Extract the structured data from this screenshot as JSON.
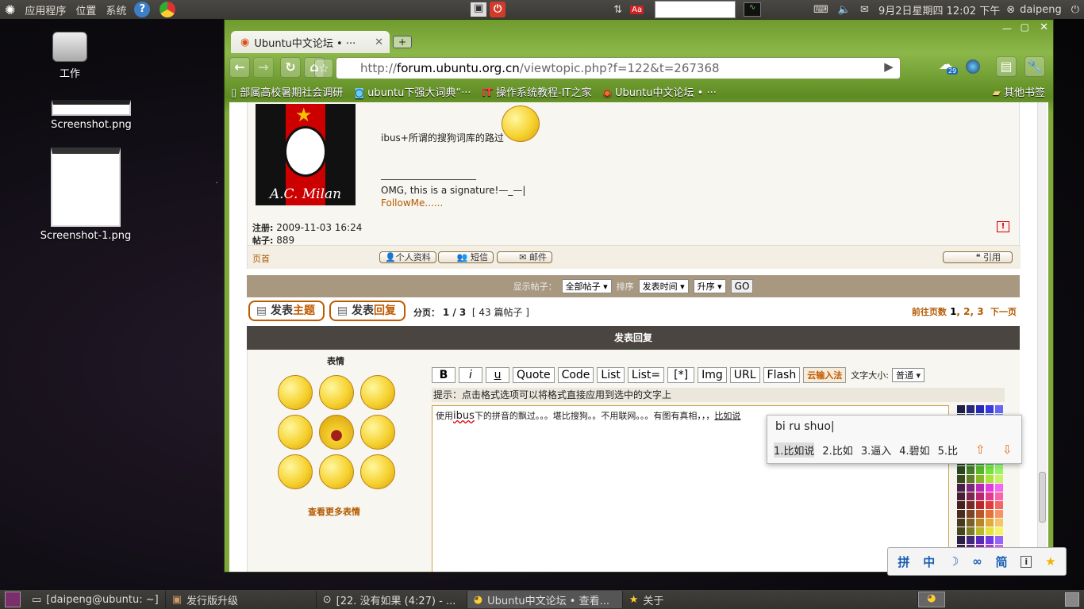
{
  "top_panel": {
    "menu_apps": "应用程序",
    "menu_places": "位置",
    "menu_system": "系统",
    "clock": "9月2日星期四 12:02 下午",
    "user": "daipeng",
    "keyboard_indicator": "Aa"
  },
  "desktop": {
    "icons": [
      {
        "label": "工作"
      },
      {
        "label": "Screenshot.png"
      },
      {
        "label": "Screenshot-1.png"
      }
    ]
  },
  "browser": {
    "tab_title": "Ubuntu中文论坛 • ···",
    "url_prefix": "http://",
    "url_host": "forum.ubuntu.org.cn",
    "url_path": "/viewtopic.php?f=122&t=267368",
    "weather_badge": "29",
    "bookmarks": [
      "部属高校暑期社会调研",
      "ubuntu下强大词典“···",
      "操作系统教程-IT之家",
      "Ubuntu中文论坛 • ···"
    ],
    "other_bookmarks": "其他书签"
  },
  "post": {
    "avatar_text": "A.C. Milan",
    "body_text": "ibus+所谓的搜狗词库的路过",
    "signature_line": "____________________",
    "signature": "OMG, this is a signature!—_—|",
    "followme": "FollowMe......",
    "reg_label": "注册:",
    "reg_date": "2009-11-03 16:24",
    "posts_label": "帖子:",
    "posts_count": "889",
    "top_link": "页首",
    "btn_profile": "个人资料",
    "btn_pm": "短信",
    "btn_email": "邮件",
    "btn_quote": "引用"
  },
  "display_bar": {
    "show_label": "显示帖子：",
    "show_value": "全部帖子",
    "sort_label": "排序",
    "sort_value": "发表时间",
    "order_value": "升序",
    "go": "GO"
  },
  "pagination": {
    "new_topic_a": "发表",
    "new_topic_b": "主题",
    "reply_a": "发表",
    "reply_b": "回复",
    "page_label": "分页：",
    "page_value": "1 / 3",
    "post_count": "[ 43 篇帖子 ]",
    "goto_label": "前往页数",
    "pages": [
      "1",
      "2",
      "3"
    ],
    "next": "下一页"
  },
  "reply": {
    "header": "发表回复",
    "smilies_title": "表情",
    "more_smilies": "查看更多表情",
    "buttons": [
      "B",
      "i",
      "u",
      "Quote",
      "Code",
      "List",
      "List=",
      "[*]",
      "Img",
      "URL",
      "Flash"
    ],
    "cloud_ime": "云输入法",
    "font_size_label": "文字大小:",
    "font_size_value": "普通",
    "hint": "提示：点击格式选项可以将格式直接应用到选中的文字上",
    "textarea_before": "使用",
    "textarea_ibus": "ibus",
    "textarea_after": "下的拼音的飘过。。。堪比搜狗。。不用联网。。。有图有真相，，，",
    "textarea_preedit": "比如说"
  },
  "ime": {
    "preedit": "bi ru shuo|",
    "candidates": [
      "1.比如说",
      "2.比如",
      "3.逼入",
      "4.碧如",
      "5.比"
    ],
    "toolbar": [
      "拼",
      "中",
      "☽",
      "∞",
      "简",
      "i",
      "★"
    ]
  },
  "bottom_panel": {
    "tasks": [
      "[daipeng@ubuntu: ~]",
      "发行版升级",
      "[22. 没有如果 (4:27) - ...",
      "Ubuntu中文论坛 • 查看...",
      "关于"
    ]
  },
  "colors": {
    "forum_dark": "#4a4540",
    "forum_tan": "#a89880",
    "accent_orange": "#c05a00",
    "link_brown": "#b35a00"
  }
}
